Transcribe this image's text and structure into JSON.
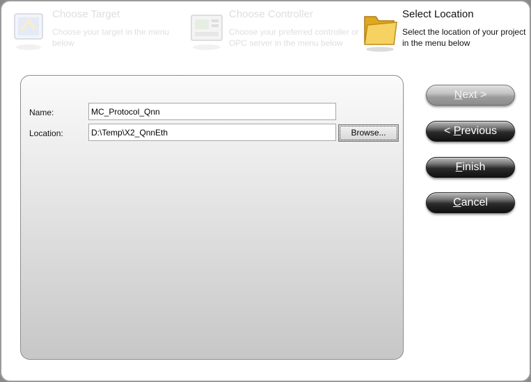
{
  "steps": [
    {
      "title": "Choose Target",
      "desc": "Choose your target in the menu below",
      "icon": "target-icon",
      "state": "inactive"
    },
    {
      "title": "Choose Controller",
      "desc": "Choose your preferred controller or OPC server in the menu below",
      "icon": "controller-icon",
      "state": "inactive"
    },
    {
      "title": "Select Location",
      "desc": "Select the location of your project in the menu below",
      "icon": "folder-icon",
      "state": "active"
    }
  ],
  "form": {
    "name_label": "Name:",
    "name_value": "MC_Protocol_Qnn",
    "location_label": "Location:",
    "location_value": "D:\\Temp\\X2_QnnEth",
    "browse_label": "Browse..."
  },
  "buttons": {
    "next_key": "N",
    "next_rest": "ext >",
    "previous_prefix": "< ",
    "previous_key": "P",
    "previous_rest": "revious",
    "finish_key": "F",
    "finish_rest": "inish",
    "cancel_key": "C",
    "cancel_rest": "ancel"
  },
  "colors": {
    "folder": "#f2c94c",
    "button_dark": "#1a1a1a",
    "panel_border": "#8c8c8c"
  }
}
